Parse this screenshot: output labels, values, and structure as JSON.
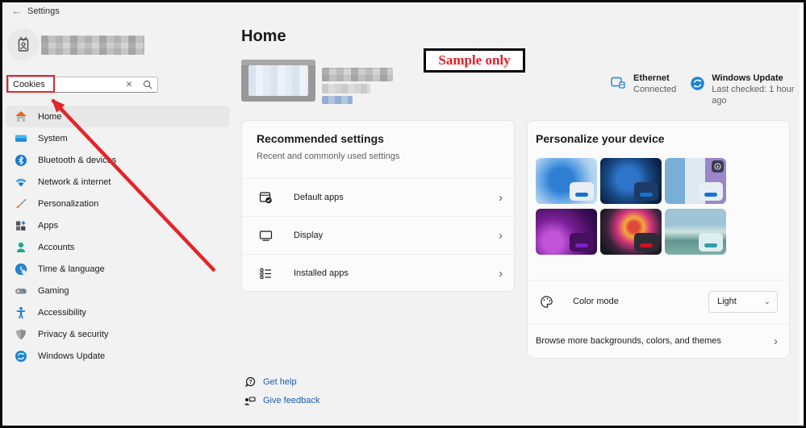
{
  "palette": {
    "accent_blue": "#0078d4",
    "link_blue": "#1a5dab",
    "annotation_red": "#e2262a",
    "background": "#f2f2f2",
    "card_bg": "#fbfbfb",
    "tile_accents": [
      "#1573d2",
      "#1573d2",
      "#1573d2",
      "#7d20c8",
      "#d31020",
      "#2e9cb0"
    ]
  },
  "titlebar": {
    "back_icon": "←",
    "title": "Settings"
  },
  "sidebar": {
    "search": {
      "value": "Cookies",
      "clear_icon": "✕"
    },
    "items": [
      {
        "label": "Home",
        "selected": true
      },
      {
        "label": "System"
      },
      {
        "label": "Bluetooth & devices"
      },
      {
        "label": "Network & internet"
      },
      {
        "label": "Personalization"
      },
      {
        "label": "Apps"
      },
      {
        "label": "Accounts"
      },
      {
        "label": "Time & language"
      },
      {
        "label": "Gaming"
      },
      {
        "label": "Accessibility"
      },
      {
        "label": "Privacy & security"
      },
      {
        "label": "Windows Update"
      }
    ]
  },
  "main": {
    "page_title": "Home",
    "sample_label": "Sample only",
    "status": {
      "ethernet": {
        "title": "Ethernet",
        "subtitle": "Connected"
      },
      "windows_update": {
        "title": "Windows Update",
        "subtitle": "Last checked: 1 hour ago"
      }
    },
    "recommended": {
      "title": "Recommended settings",
      "subtitle": "Recent and commonly used settings",
      "rows": [
        {
          "label": "Default apps"
        },
        {
          "label": "Display"
        },
        {
          "label": "Installed apps"
        }
      ],
      "chevron": "›"
    },
    "personalize": {
      "title": "Personalize your device",
      "color_mode_label": "Color mode",
      "color_mode_value": "Light",
      "dropdown_chevron": "⌄",
      "browse_label": "Browse more backgrounds, colors, and themes",
      "chevron": "›"
    },
    "footer": {
      "get_help": "Get help",
      "give_feedback": "Give feedback"
    }
  }
}
